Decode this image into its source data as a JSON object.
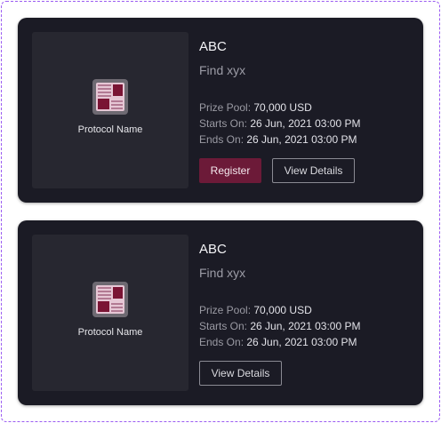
{
  "colors": {
    "card_bg": "#1b1b25",
    "thumb_bg": "#272730",
    "register_bg": "#6c1a38",
    "frame_border": "#9b5cf2"
  },
  "cards": [
    {
      "protocol_name": "Protocol Name",
      "logo_icon": "protocol-logo-icon",
      "title": "ABC",
      "subtitle": "Find xyx",
      "prize_pool_label": "Prize Pool:",
      "prize_pool_value": "70,000 USD",
      "starts_label": "Starts On:",
      "starts_value": "26 Jun, 2021 03:00 PM",
      "ends_label": "Ends On:",
      "ends_value": "26 Jun, 2021 03:00 PM",
      "register_label": "Register",
      "details_label": "View Details"
    },
    {
      "protocol_name": "Protocol Name",
      "logo_icon": "protocol-logo-icon",
      "title": "ABC",
      "subtitle": "Find xyx",
      "prize_pool_label": "Prize Pool:",
      "prize_pool_value": "70,000 USD",
      "starts_label": "Starts On:",
      "starts_value": "26 Jun, 2021 03:00 PM",
      "ends_label": "Ends On:",
      "ends_value": "26 Jun, 2021 03:00 PM",
      "details_label": "View Details"
    }
  ]
}
